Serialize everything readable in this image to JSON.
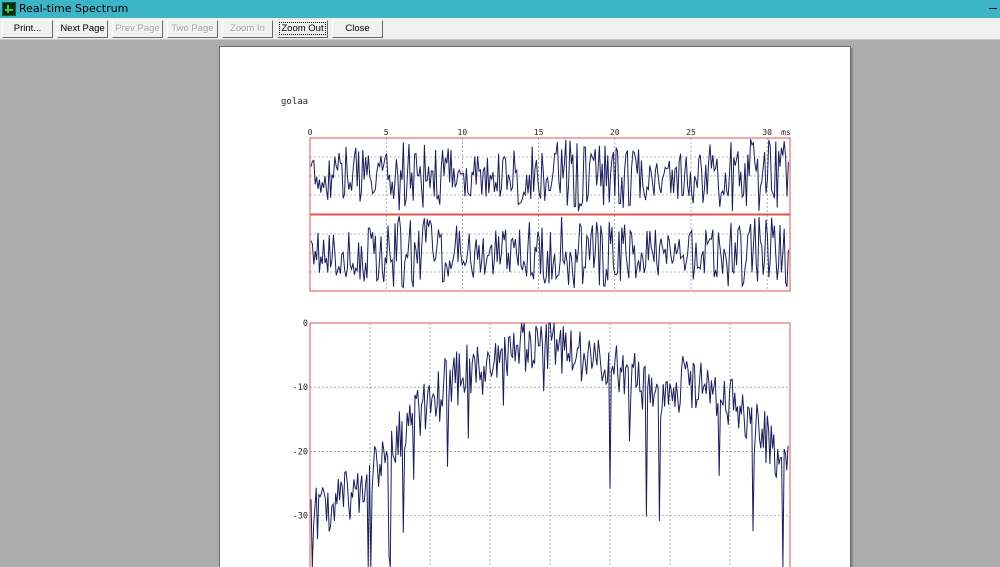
{
  "window": {
    "title": "Real-time Spectrum"
  },
  "toolbar": {
    "buttons": [
      {
        "label": "Print...",
        "enabled": true
      },
      {
        "label": "Next Page",
        "enabled": true
      },
      {
        "label": "Prev Page",
        "enabled": false
      },
      {
        "label": "Two Page",
        "enabled": false
      },
      {
        "label": "Zoom In",
        "enabled": false
      },
      {
        "label": "Zoom Out",
        "enabled": true,
        "focused": true
      },
      {
        "label": "Close",
        "enabled": true
      }
    ]
  },
  "document": {
    "heading": "golaa"
  },
  "chart_data": [
    {
      "type": "line",
      "description": "waveform, two stacked channels",
      "xlim": [
        0,
        31.5
      ],
      "x_ticks": [
        0,
        5,
        10,
        15,
        20,
        25,
        30
      ],
      "x_unit": "ms",
      "channels": 2,
      "grid": true,
      "colors": {
        "trace": "#1c1c5a",
        "frame": "#e05050",
        "grid": "#777777"
      }
    },
    {
      "type": "line",
      "description": "spectrum magnitude",
      "ylim": [
        -38,
        0
      ],
      "y_ticks": [
        0,
        -10,
        -20,
        -30
      ],
      "grid": true,
      "envelope_points": [
        [
          0.0,
          -28
        ],
        [
          0.06,
          -27
        ],
        [
          0.12,
          -23
        ],
        [
          0.18,
          -17
        ],
        [
          0.25,
          -11
        ],
        [
          0.32,
          -7
        ],
        [
          0.4,
          -4
        ],
        [
          0.48,
          -2
        ],
        [
          0.55,
          -4
        ],
        [
          0.62,
          -6
        ],
        [
          0.68,
          -8
        ],
        [
          0.73,
          -10
        ],
        [
          0.78,
          -8
        ],
        [
          0.84,
          -9
        ],
        [
          0.9,
          -13
        ],
        [
          0.96,
          -18
        ],
        [
          1.0,
          -21
        ]
      ],
      "colors": {
        "trace": "#1c1c5a",
        "frame": "#e05050",
        "grid": "#777777"
      }
    }
  ]
}
